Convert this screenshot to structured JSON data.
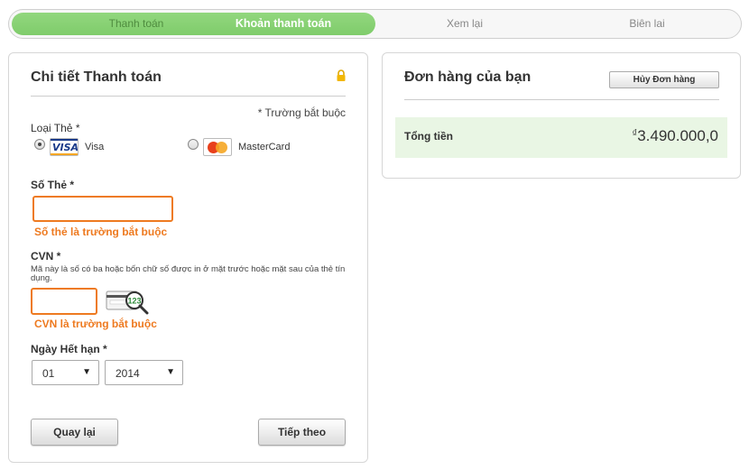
{
  "stepper": {
    "steps": [
      {
        "label": "Thanh toán",
        "state": "done"
      },
      {
        "label": "Khoản thanh toán",
        "state": "active"
      },
      {
        "label": "Xem lại",
        "state": "pending"
      },
      {
        "label": "Biên lai",
        "state": "pending"
      }
    ],
    "active_color": "#7fcc6b"
  },
  "payment": {
    "title": "Chi tiết Thanh toán",
    "lock_icon": "lock-icon",
    "required_note": "* Trường bắt buộc",
    "card_type": {
      "label": "Loại Thẻ *",
      "options": [
        {
          "logo": "VISA",
          "name": "Visa",
          "checked": true
        },
        {
          "logo": "MC",
          "name": "MasterCard",
          "checked": false
        }
      ]
    },
    "card_number": {
      "label": "Số Thẻ *",
      "value": "",
      "error": "Số thẻ là trường bắt buộc"
    },
    "cvn": {
      "label": "CVN *",
      "hint": "Mã này là số có ba hoặc bốn chữ số được in ở mặt trước hoặc mặt sau của thẻ tín dụng.",
      "value": "",
      "icon_text": "123",
      "error": "CVN là trường bắt buộc"
    },
    "expiry": {
      "label": "Ngày Hết hạn *",
      "month": "01",
      "year": "2014"
    },
    "back_label": "Quay lại",
    "next_label": "Tiếp theo"
  },
  "order": {
    "title": "Đơn hàng của bạn",
    "cancel_label": "Hủy Đơn hàng",
    "total_label": "Tổng tiền",
    "currency_symbol": "₫",
    "total_value": "3.490.000,0"
  },
  "colors": {
    "error": "#ee7a20",
    "total_bg": "#e9f6e4"
  }
}
